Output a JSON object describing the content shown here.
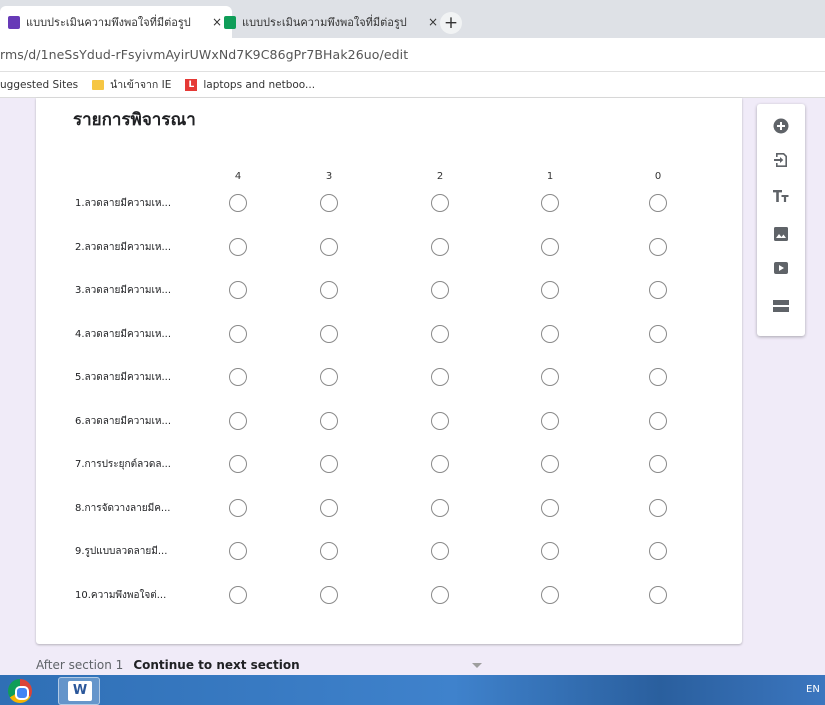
{
  "browser": {
    "tabs": [
      {
        "label": "แบบประเมินความพึงพอใจที่มีต่อรูป",
        "close": "×",
        "icon": "google-forms-icon",
        "color": "#673ab7"
      },
      {
        "label": "แบบประเมินความพึงพอใจที่มีต่อรูป",
        "close": "×",
        "icon": "google-sheets-icon",
        "color": "#0f9d58"
      }
    ],
    "new_tab": "+",
    "url": "rms/d/1neSsYdud-rFsyivmAyirUWxNd7K9C86gPr7BHak26uo/edit",
    "bookmarks": [
      {
        "label": "uggested Sites",
        "icon": "none"
      },
      {
        "label": "นำเข้าจาก IE",
        "icon": "folder-icon"
      },
      {
        "label": "laptops and netboo...",
        "icon": "bookmark-l-icon",
        "icon_text": "L"
      }
    ]
  },
  "form": {
    "section_title": "รายการพิจารณา",
    "columns": [
      "4",
      "3",
      "2",
      "1",
      "0"
    ],
    "rows": [
      "1.ลวดลายมีความเห...",
      "2.ลวดลายมีความเห...",
      "3.ลวดลายมีความเห...",
      "4.ลวดลายมีความเห...",
      "5.ลวดลายมีความเห...",
      "6.ลวดลายมีความเห...",
      "7.การประยุกต์ลวดล...",
      "8.การจัดวางลายมีค...",
      "9.รูปแบบลวดลายมี...",
      "10.ความพึงพอใจต่..."
    ],
    "after_section": {
      "label": "After section 1",
      "value": "Continue to next section"
    }
  },
  "sidebar": [
    "add-question-icon",
    "import-questions-icon",
    "add-title-icon",
    "add-image-icon",
    "add-video-icon",
    "add-section-icon"
  ],
  "taskbar": {
    "language": "EN",
    "word_letter": "W"
  }
}
